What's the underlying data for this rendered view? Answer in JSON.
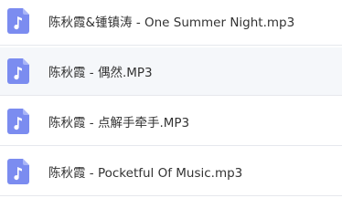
{
  "files": [
    {
      "name": "陈秋霞&锺镇涛 - One Summer Night.mp3",
      "icon": "music-file-icon"
    },
    {
      "name": "陈秋霞 - 偶然.MP3",
      "icon": "music-file-icon"
    },
    {
      "name": "陈秋霞 - 点解手牵手.MP3",
      "icon": "music-file-icon"
    },
    {
      "name": "陈秋霞 - Pocketful Of Music.mp3",
      "icon": "music-file-icon"
    }
  ],
  "colors": {
    "icon_bg": "#7b8cf0",
    "icon_fold": "#aab6f7",
    "row_alt_bg": "#f5f7fa",
    "text": "#333333",
    "divider": "#e6e8ed"
  }
}
